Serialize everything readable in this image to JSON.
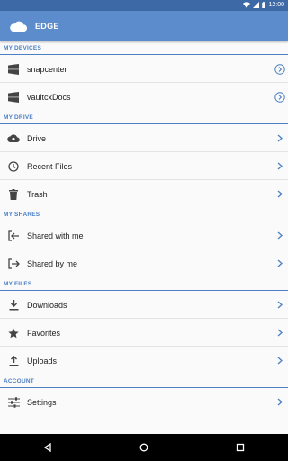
{
  "status_bar": {
    "time": "12:00"
  },
  "app_bar": {
    "title": "EDGE"
  },
  "sections": [
    {
      "header": "MY DEVICES",
      "items": [
        {
          "label": "snapcenter",
          "icon": "windows-icon",
          "chevron": "circle-chevron"
        },
        {
          "label": "vaultcxDocs",
          "icon": "windows-icon",
          "chevron": "circle-chevron"
        }
      ]
    },
    {
      "header": "MY DRIVE",
      "items": [
        {
          "label": "Drive",
          "icon": "cloud-icon",
          "chevron": "chevron"
        },
        {
          "label": "Recent Files",
          "icon": "clock-icon",
          "chevron": "chevron"
        },
        {
          "label": "Trash",
          "icon": "trash-icon",
          "chevron": "chevron"
        }
      ]
    },
    {
      "header": "MY SHARES",
      "items": [
        {
          "label": "Shared with me",
          "icon": "share-in-icon",
          "chevron": "chevron"
        },
        {
          "label": "Shared by me",
          "icon": "share-out-icon",
          "chevron": "chevron"
        }
      ]
    },
    {
      "header": "MY FILES",
      "items": [
        {
          "label": "Downloads",
          "icon": "download-icon",
          "chevron": "chevron"
        },
        {
          "label": "Favorites",
          "icon": "star-icon",
          "chevron": "chevron"
        },
        {
          "label": "Uploads",
          "icon": "upload-icon",
          "chevron": "chevron"
        }
      ]
    },
    {
      "header": "ACCOUNT",
      "items": [
        {
          "label": "Settings",
          "icon": "settings-sliders-icon",
          "chevron": "chevron"
        }
      ]
    }
  ],
  "colors": {
    "status_bar": "#3d6aa6",
    "app_bar": "#5d8ccc",
    "accent": "#4b80c4",
    "nav_bar": "#000000"
  },
  "nav_bar": {
    "buttons": [
      "back-icon",
      "home-icon",
      "recents-icon"
    ]
  }
}
